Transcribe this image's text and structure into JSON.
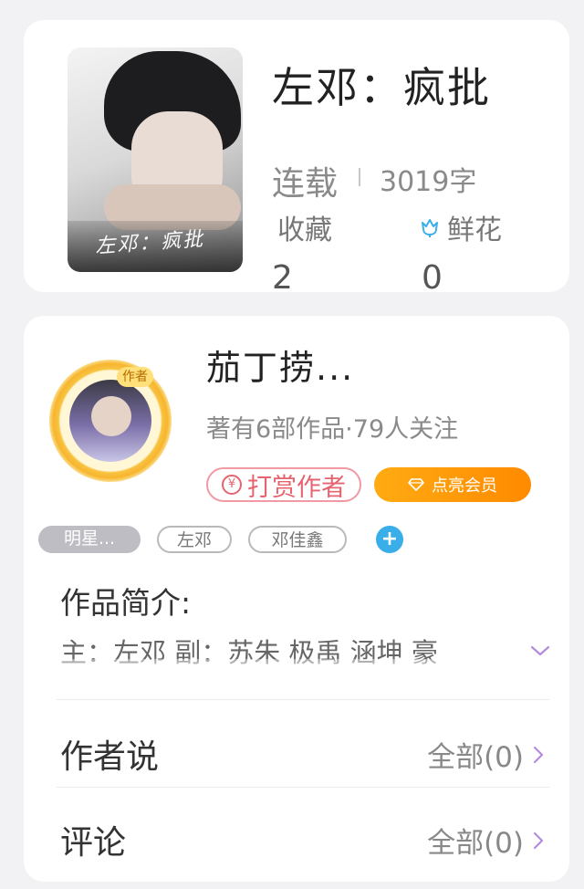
{
  "book": {
    "cover_text": "左邓：疯批",
    "title": "左邓：疯批",
    "status": "连载",
    "word_count": "3019字",
    "favorites_label": "收藏",
    "favorites_count": "2",
    "flowers_label": "鲜花",
    "flowers_count": "0"
  },
  "author": {
    "avatar_tag": "作者",
    "name": "茄丁捞...",
    "meta": "著有6部作品·79人关注",
    "tip_label": "打赏作者",
    "tip_icon": "¥",
    "vip_label": "点亮会员"
  },
  "tags": {
    "items": [
      "明星...",
      "左邓",
      "邓佳鑫"
    ],
    "add_symbol": "+"
  },
  "intro": {
    "heading": "作品简介:",
    "text": "主：左邓 副：苏朱 极禹 涵坤 豪"
  },
  "author_says": {
    "label": "作者说",
    "link": "全部(0)"
  },
  "comments": {
    "label": "评论",
    "link": "全部(0)"
  },
  "colors": {
    "accent_orange": "#ff8a00",
    "tip_pink": "#e5646f",
    "add_blue": "#3aaee8",
    "expand_purple": "#b58be0"
  }
}
